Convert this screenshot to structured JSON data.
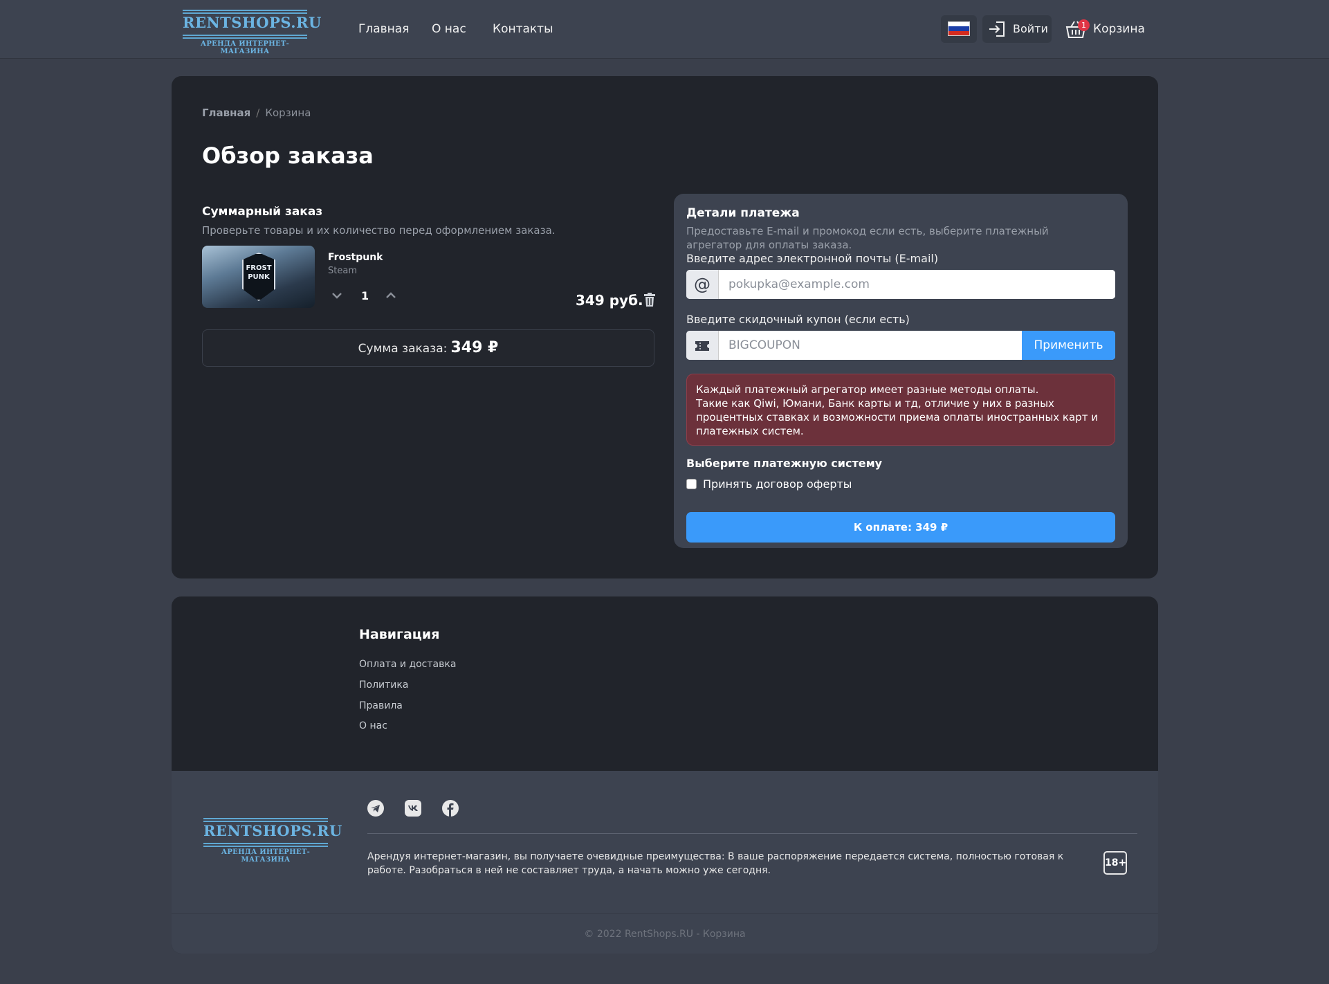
{
  "header": {
    "logo_title": "RENTSHOPS.RU",
    "logo_sub": "АРЕНДА ИНТЕРНЕТ-МАГАЗИНА",
    "nav": [
      "Главная",
      "О нас",
      "Контакты"
    ],
    "language_icon": "russia-flag-icon",
    "login_label": "Войти",
    "cart_label": "Корзина",
    "cart_count": "1"
  },
  "breadcrumb": {
    "home": "Главная",
    "separator": "/",
    "current": "Корзина"
  },
  "page_title": "Обзор заказа",
  "summary": {
    "title": "Суммарный заказ",
    "subtitle": "Проверьте товары и их количество перед оформлением заказа.",
    "item": {
      "name": "Frostpunk",
      "platform": "Steam",
      "quantity": "1",
      "price": "349 руб.",
      "image_text": "FROST PUNK"
    },
    "total_label": "Сумма заказа:",
    "total_value": "349 ₽"
  },
  "payment": {
    "title": "Детали платежа",
    "subtitle": "Предоставьте E-mail и промокод если есть, выберите платежный агрегатор для оплаты заказа.",
    "email_label": "Введите адрес электронной почты (E-mail)",
    "email_placeholder": "pokupka@example.com",
    "email_addon": "@",
    "coupon_label": "Введите скидочный купон (если есть)",
    "coupon_placeholder": "BIGCOUPON",
    "apply_label": "Применить",
    "alert_line1": "Каждый платежный агрегатор имеет разные методы оплаты.",
    "alert_line2": "Такие как Qiwi, Юмани, Банк карты и тд, отличие у них в разных процентных ставках и возможности приема оплаты иностранных карт и платежных систем.",
    "pay_system_title": "Выберите платежную систему",
    "offer_label": "Принять договор оферты",
    "pay_button": "К оплате: 349 ₽"
  },
  "footer": {
    "nav_title": "Навигация",
    "links": [
      "Оплата и доставка",
      "Политика",
      "Правила",
      "О нас"
    ],
    "socials": [
      "telegram-icon",
      "vk-icon",
      "facebook-icon"
    ],
    "description": "Арендуя интернет-магазин, вы получаете очевидные преимущества: В ваше распоряжение передается система, полностью готовая к работе. Разобраться в ней не составляет труда, а начать можно уже сегодня.",
    "age": "18+",
    "copyright": "© 2022 RentShops.RU - Корзина"
  },
  "colors": {
    "accent": "#3a9afa",
    "background": "#3a3f4b",
    "card": "#21242b",
    "panel": "#3d4350",
    "alert": "#6c313b",
    "badge": "#e03545"
  }
}
